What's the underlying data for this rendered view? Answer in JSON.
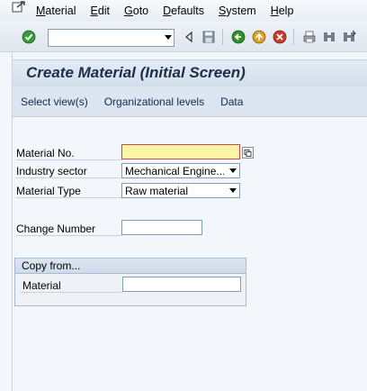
{
  "menubar": {
    "logo_icon": "sap-exit-icon",
    "items": [
      {
        "mnemonic": "M",
        "rest": "aterial"
      },
      {
        "mnemonic": "E",
        "rest": "dit"
      },
      {
        "mnemonic": "G",
        "rest": "oto"
      },
      {
        "mnemonic": "D",
        "rest": "efaults"
      },
      {
        "mnemonic": "S",
        "rest": "ystem"
      },
      {
        "mnemonic": "H",
        "rest": "elp"
      }
    ]
  },
  "toolbar": {
    "command_field": {
      "value": "",
      "placeholder": ""
    },
    "icons": [
      "enter-icon",
      "back-arrow-icon",
      "save-icon",
      "back-icon",
      "exit-icon",
      "cancel-icon",
      "print-icon",
      "find-icon",
      "find-next-icon"
    ],
    "colors": {
      "enter": "#3a9a3a",
      "back": "#2f8f2f",
      "exit": "#d9a020",
      "cancel": "#c93a2a"
    }
  },
  "screen": {
    "title": "Create Material (Initial Screen)",
    "app_toolbar": [
      "Select view(s)",
      "Organizational levels",
      "Data"
    ]
  },
  "form": {
    "material_no": {
      "label": "Material No.",
      "value": ""
    },
    "industry_sector": {
      "label": "Industry sector",
      "value": "Mechanical Engine..."
    },
    "material_type": {
      "label": "Material Type",
      "value": "Raw material"
    },
    "change_number": {
      "label": "Change Number",
      "value": ""
    },
    "copy_from": {
      "title": "Copy from...",
      "material": {
        "label": "Material",
        "value": ""
      }
    }
  }
}
